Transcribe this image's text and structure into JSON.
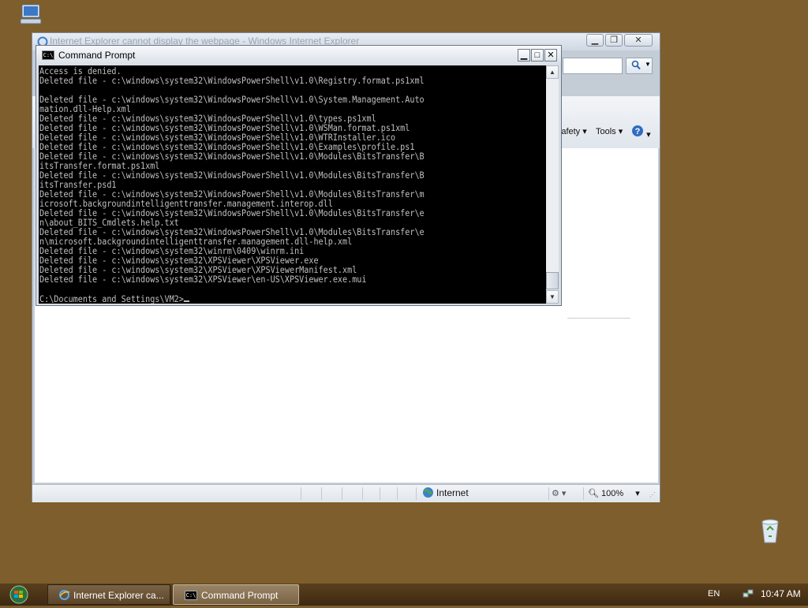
{
  "ie": {
    "title": "Internet Explorer cannot display the webpage - Windows Internet Explorer",
    "tools_menu_label": "Tools",
    "safety_menu_label": "Safety",
    "zone_label": "Internet",
    "zoom_label": "100%"
  },
  "cmd": {
    "title": "Command Prompt",
    "lines": [
      "Access is denied.",
      "Deleted file - c:\\windows\\system32\\WindowsPowerShell\\v1.0\\Registry.format.ps1xml",
      "",
      "Deleted file - c:\\windows\\system32\\WindowsPowerShell\\v1.0\\System.Management.Auto",
      "mation.dll-Help.xml",
      "Deleted file - c:\\windows\\system32\\WindowsPowerShell\\v1.0\\types.ps1xml",
      "Deleted file - c:\\windows\\system32\\WindowsPowerShell\\v1.0\\WSMan.format.ps1xml",
      "Deleted file - c:\\windows\\system32\\WindowsPowerShell\\v1.0\\WTRInstaller.ico",
      "Deleted file - c:\\windows\\system32\\WindowsPowerShell\\v1.0\\Examples\\profile.ps1",
      "Deleted file - c:\\windows\\system32\\WindowsPowerShell\\v1.0\\Modules\\BitsTransfer\\B",
      "itsTransfer.format.ps1xml",
      "Deleted file - c:\\windows\\system32\\WindowsPowerShell\\v1.0\\Modules\\BitsTransfer\\B",
      "itsTransfer.psd1",
      "Deleted file - c:\\windows\\system32\\WindowsPowerShell\\v1.0\\Modules\\BitsTransfer\\m",
      "icrosoft.backgroundintelligenttransfer.management.interop.dll",
      "Deleted file - c:\\windows\\system32\\WindowsPowerShell\\v1.0\\Modules\\BitsTransfer\\e",
      "n\\about_BITS_Cmdlets.help.txt",
      "Deleted file - c:\\windows\\system32\\WindowsPowerShell\\v1.0\\Modules\\BitsTransfer\\e",
      "n\\microsoft.backgroundintelligenttransfer.management.dll-help.xml",
      "Deleted file - c:\\windows\\system32\\winrm\\0409\\winrm.ini",
      "Deleted file - c:\\windows\\system32\\XPSViewer\\XPSViewer.exe",
      "Deleted file - c:\\windows\\system32\\XPSViewer\\XPSViewerManifest.xml",
      "Deleted file - c:\\windows\\system32\\XPSViewer\\en-US\\XPSViewer.exe.mui",
      ""
    ],
    "prompt": "C:\\Documents and Settings\\VM2>"
  },
  "taskbar": {
    "ie_button_label": "Internet Explorer ca...",
    "cmd_button_label": "Command Prompt",
    "language": "EN",
    "clock": "10:47 AM"
  },
  "icons": {
    "desktop": [
      "computer-icon",
      "recycle-bin-icon"
    ],
    "ie": [
      "ie-icon",
      "search-icon",
      "globe-icon",
      "zoom-icon",
      "help-icon"
    ],
    "cmd": [
      "cmd-app-icon",
      "minimize-icon",
      "maximize-icon",
      "close-icon"
    ],
    "taskbar": [
      "start-orb-icon",
      "network-icon"
    ]
  }
}
